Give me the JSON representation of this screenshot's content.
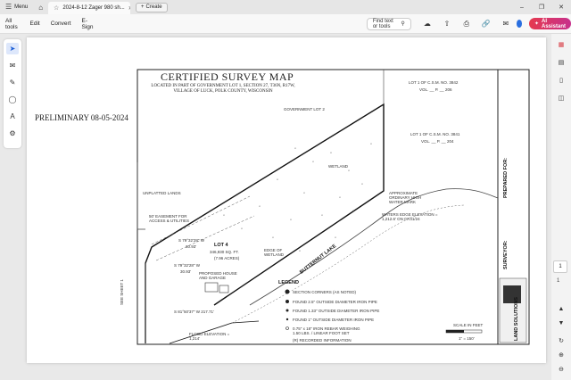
{
  "titlebar": {
    "menu_label": "Menu",
    "tab_title": "2024-8-12 Zager 980 sh...",
    "create_label": "Create"
  },
  "toolbar": {
    "menu_items": [
      "All tools",
      "Edit",
      "Convert",
      "E-Sign"
    ],
    "find_label": "Find text or tools",
    "ai_label": "AI Assistant"
  },
  "pager": {
    "current_page": "1",
    "total_pages": "1"
  },
  "document": {
    "title": "CERTIFIED SURVEY MAP",
    "subtitle_line1": "LOCATED IN PART OF GOVERNMENT LOT 1, SECTION 27, T36N, R17W,",
    "subtitle_line2": "VILLAGE OF LUCK, POLK COUNTY, WISCONSIN",
    "preliminary": "PRELIMINARY 08-05-2024",
    "labels": {
      "lot1_csm_3842": "LOT 1 OF C.S.M. NO. 3842",
      "vol_3842": "VOL. __ P. __ 206",
      "lot1_csm_3841": "LOT 1 OF C.S.M. NO. 3841",
      "vol_3841": "VOL. __ P. __ 204",
      "gov_lot": "GOVERNMENT LOT 2",
      "wetland": "WETLAND",
      "unplatted": "UNPLATTED LANDS",
      "lot4": "LOT 4",
      "lot4_area": "346,930 SQ. FT.",
      "lot4_acres": "(7.96 ACRES)",
      "butternut": "BUTTERNUT LAKE",
      "easement": "50' EASEMENT FOR ACCESS & UTILITIES",
      "proposed_house": "PROPOSED HOUSE AND GARAGE",
      "edge_wetland": "EDGE OF WETLAND",
      "ohwm": "APPROXIMATE ORDINARY HIGH WATER MARK",
      "waters_edge": "WATERS EDGE ELEVATION = 1,212.6' ON 07/31/24",
      "flood_elev": "FLOOD ELEVATION = 1,214'",
      "bearing1": "S 79°32'28\" W",
      "bearing1_dist": "30.93'",
      "bearing2": "S 79°32'28\" W",
      "bearing2_dist": "30.93'",
      "bearing3": "S 81°50'37\" W   217.71'",
      "legend": "LEGEND",
      "legend_items": [
        "SECTION CORNERS (AS NOTED)",
        "FOUND 2.5\" OUTSIDE DIAMETER IRON PIPE",
        "FOUND 1.33\" OUTSIDE DIAMETER IRON PIPE",
        "FOUND 1\" OUTSIDE DIAMETER IRON PIPE",
        "0.75\" x 18\" IRON REBAR WEIGHING 1.50 LBS. / LINEAR FOOT SET",
        "(R) RECORDED INFORMATION"
      ],
      "scale": "SCALE IN FEET",
      "scale_ratio": "1\" = 150'",
      "see_sheet": "SEE SHEET 1",
      "surveyor": "SURVEYOR:",
      "prepared_for": "PREPARED FOR:",
      "land_solutions": "LAND SOLUTIONS"
    }
  }
}
